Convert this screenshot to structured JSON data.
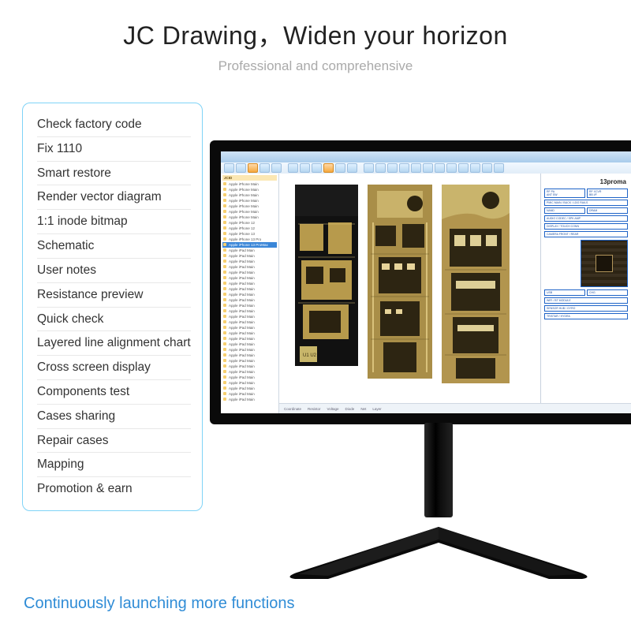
{
  "header": {
    "title": "JC Drawing，Widen your horizon",
    "subtitle": "Professional and comprehensive"
  },
  "features": [
    "Check factory code",
    "Fix 1110",
    "Smart restore",
    "Render vector diagram",
    "1:1 inode bitmap",
    "Schematic",
    "User notes",
    "Resistance preview",
    "Quick check",
    "Layered line alignment chart",
    "Cross screen display",
    "Components test",
    "Cases sharing",
    "Repair cases",
    "Mapping",
    "Promotion & earn"
  ],
  "footer": "Continuously launching more functions",
  "app": {
    "tree_header": "JCID",
    "tree_items": [
      "Apple iPhone Main",
      "Apple iPhone Main",
      "Apple iPhone Main",
      "Apple iPhone Main",
      "Apple iPhone Main",
      "Apple iPhone Main",
      "Apple iPhone Main",
      "Apple iPhone 12",
      "Apple iPhone 12",
      "Apple iPhone 13",
      "Apple iPhone 13 Pro",
      "Apple iPhone 13 ProMax",
      "Apple iPad Main",
      "Apple iPad Main",
      "Apple iPad Main",
      "Apple iPad Main",
      "Apple iPad Main",
      "Apple iPad Main",
      "Apple iPad Main",
      "Apple iPad Main",
      "Apple iPad Main",
      "Apple iPad Main",
      "Apple iPad Main",
      "Apple iPad Main",
      "Apple iPad Main",
      "Apple iPad Main",
      "Apple iPad Main",
      "Apple iPad Main",
      "Apple iPad Main",
      "Apple iPad Main",
      "Apple iPad Main",
      "Apple iPad Main",
      "Apple iPad Main",
      "Apple iPad Main",
      "Apple iPad Main",
      "Apple iPad Main",
      "Apple iPad Main",
      "Apple iPad Main",
      "Apple iPad Main",
      "Apple iPad Main"
    ],
    "tree_selected_index": 11,
    "schematic_title": "13proma",
    "status_items": [
      "Coordinate",
      "Resistor",
      "Voltage",
      "Diode",
      "Net",
      "Layer"
    ]
  }
}
